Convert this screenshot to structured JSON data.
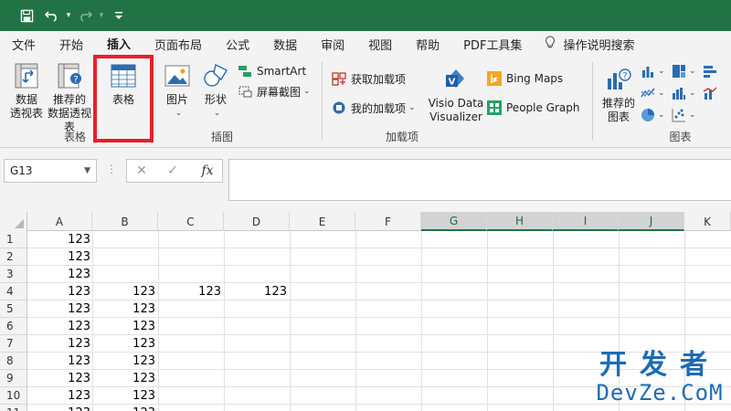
{
  "qat": {
    "save": "save-icon",
    "undo": "undo-icon",
    "redo": "redo-icon",
    "customize": "customize-icon"
  },
  "tabs": [
    "文件",
    "开始",
    "插入",
    "页面布局",
    "公式",
    "数据",
    "审阅",
    "视图",
    "帮助",
    "PDF工具集"
  ],
  "active_tab": "插入",
  "search_label": "操作说明搜索",
  "ribbon": {
    "tables": {
      "label": "表格",
      "pivot": [
        "数据",
        "透视表"
      ],
      "recommended_pivot": [
        "推荐的",
        "数据透视表"
      ],
      "table": "表格"
    },
    "illustrations": {
      "label": "插图",
      "pictures": "图片",
      "shapes": "形状",
      "smartart": "SmartArt",
      "screenshot": "屏幕截图"
    },
    "addins": {
      "label": "加载项",
      "get_addins": "获取加载项",
      "my_addins": "我的加载项",
      "visio": [
        "Visio Data",
        "Visualizer"
      ],
      "bing_maps": "Bing Maps",
      "people_graph": "People Graph"
    },
    "charts": {
      "label": "图表",
      "recommended": [
        "推荐的",
        "图表"
      ]
    }
  },
  "formula_bar": {
    "name_box": "G13",
    "fx": "fx",
    "formula": ""
  },
  "columns": [
    "A",
    "B",
    "C",
    "D",
    "E",
    "F",
    "G",
    "H",
    "I",
    "J",
    "K"
  ],
  "selected_columns": [
    "G",
    "H",
    "I",
    "J"
  ],
  "rows": [
    "1",
    "2",
    "3",
    "4",
    "5",
    "6",
    "7",
    "8",
    "9",
    "10",
    "11"
  ],
  "cells": [
    {
      "row": 1,
      "col": "A",
      "value": "123"
    },
    {
      "row": 2,
      "col": "A",
      "value": "123"
    },
    {
      "row": 3,
      "col": "A",
      "value": "123"
    },
    {
      "row": 4,
      "col": "A",
      "value": "123"
    },
    {
      "row": 4,
      "col": "B",
      "value": "123"
    },
    {
      "row": 4,
      "col": "C",
      "value": "123"
    },
    {
      "row": 4,
      "col": "D",
      "value": "123"
    },
    {
      "row": 5,
      "col": "A",
      "value": "123"
    },
    {
      "row": 5,
      "col": "B",
      "value": "123"
    },
    {
      "row": 6,
      "col": "A",
      "value": "123"
    },
    {
      "row": 6,
      "col": "B",
      "value": "123"
    },
    {
      "row": 7,
      "col": "A",
      "value": "123"
    },
    {
      "row": 7,
      "col": "B",
      "value": "123"
    },
    {
      "row": 8,
      "col": "A",
      "value": "123"
    },
    {
      "row": 8,
      "col": "B",
      "value": "123"
    },
    {
      "row": 9,
      "col": "A",
      "value": "123"
    },
    {
      "row": 9,
      "col": "B",
      "value": "123"
    },
    {
      "row": 10,
      "col": "A",
      "value": "123"
    },
    {
      "row": 10,
      "col": "B",
      "value": "123"
    },
    {
      "row": 11,
      "col": "A",
      "value": "123"
    },
    {
      "row": 11,
      "col": "B",
      "value": "123"
    }
  ],
  "watermark": {
    "cn": "开发者",
    "en": "DevZe.CoM"
  },
  "colors": {
    "excel_green": "#217346",
    "highlight_red": "#e8202a",
    "watermark_blue": "#1d6bb4"
  }
}
